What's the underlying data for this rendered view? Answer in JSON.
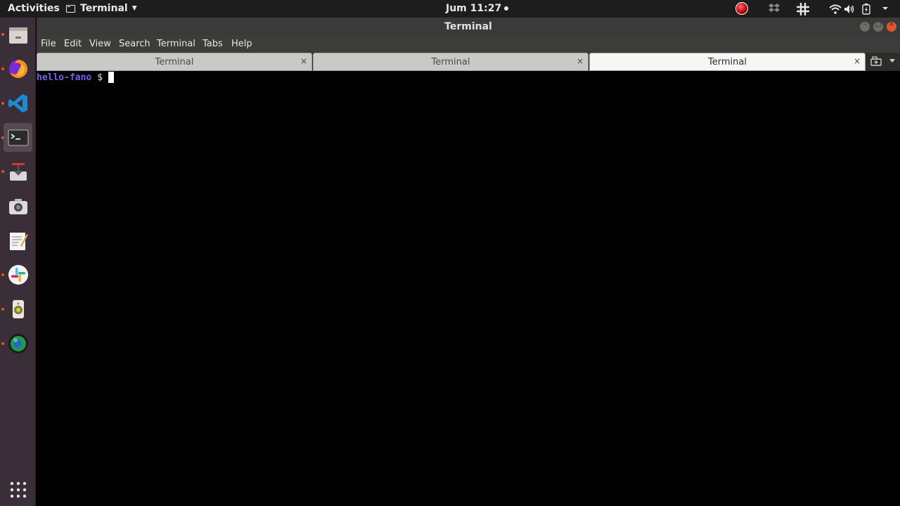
{
  "topbar": {
    "activities": "Activities",
    "app_name": "Terminal",
    "clock": "Jum 11:27"
  },
  "window": {
    "title": "Terminal",
    "menus": [
      "File",
      "Edit",
      "View",
      "Search",
      "Terminal",
      "Tabs",
      "Help"
    ],
    "tabs": [
      {
        "label": "Terminal",
        "active": false
      },
      {
        "label": "Terminal",
        "active": false
      },
      {
        "label": "Terminal",
        "active": true
      }
    ],
    "tab_close_glyph": "×"
  },
  "terminal": {
    "prompt_host": "hello-fano",
    "prompt_sign": "$"
  },
  "dock": {
    "items": [
      "files-icon",
      "firefox-icon",
      "vscode-icon",
      "terminal-icon",
      "installer-icon",
      "screenshot-icon",
      "text-editor-icon",
      "slack-icon",
      "speaker-icon",
      "globe-icon"
    ]
  },
  "colors": {
    "accent": "#e95420",
    "prompt": "#6e63e8",
    "dock_bg": "#3a2e38"
  }
}
